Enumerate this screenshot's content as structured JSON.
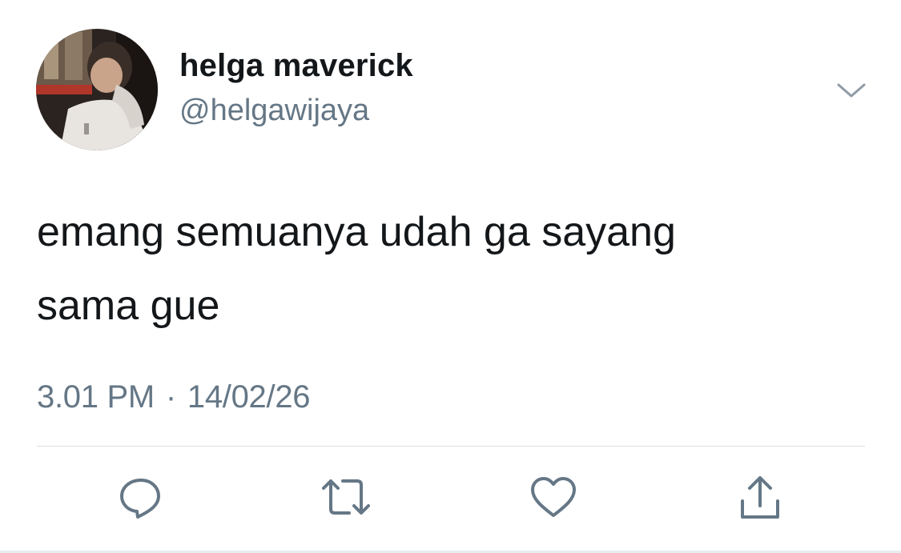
{
  "tweet": {
    "display_name": "helga maverick",
    "handle": "@helgawijaya",
    "text": "emang semuanya udah ga sayang\nsama gue",
    "time": "3.01 PM",
    "separator": "·",
    "date": "14/02/26"
  },
  "icons": {
    "menu": "chevron-down-icon",
    "reply": "reply-icon",
    "retweet": "retweet-icon",
    "like": "heart-icon",
    "share": "share-icon"
  },
  "colors": {
    "text": "#14171a",
    "secondary": "#657786",
    "divider": "#d9dee2"
  }
}
